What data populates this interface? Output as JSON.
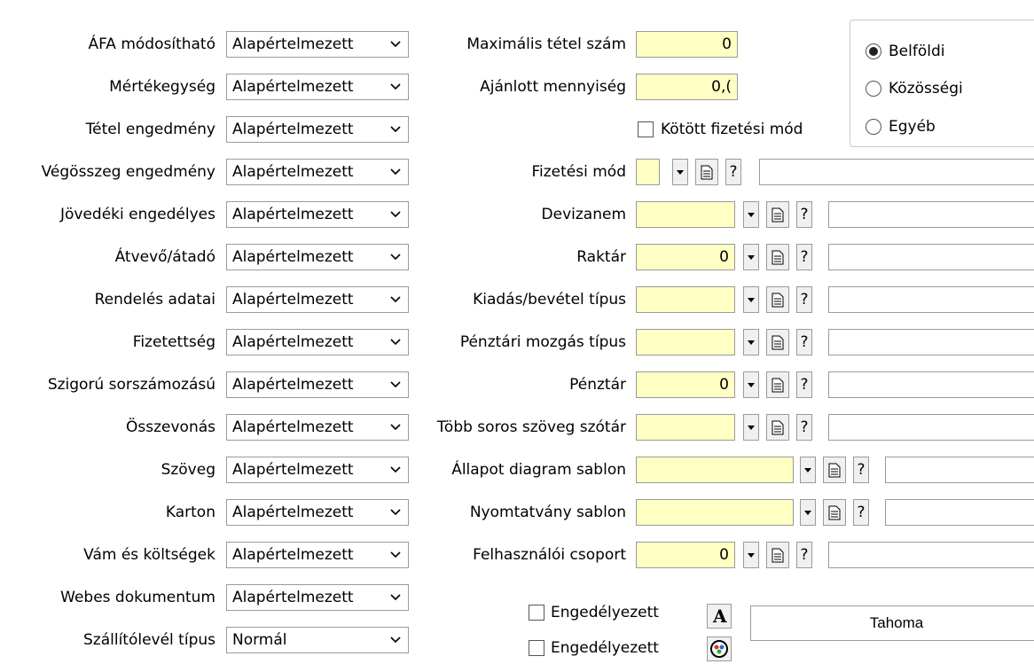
{
  "left_rows": [
    {
      "label": "ÁFA módosítható",
      "value": "Alapértelmezett"
    },
    {
      "label": "Mértékegység",
      "value": "Alapértelmezett"
    },
    {
      "label": "Tétel engedmény",
      "value": "Alapértelmezett"
    },
    {
      "label": "Végösszeg engedmény",
      "value": "Alapértelmezett"
    },
    {
      "label": "Jövedéki engedélyes",
      "value": "Alapértelmezett"
    },
    {
      "label": "Átvevő/átadó",
      "value": "Alapértelmezett"
    },
    {
      "label": "Rendelés adatai",
      "value": "Alapértelmezett"
    },
    {
      "label": "Fizetettség",
      "value": "Alapértelmezett"
    },
    {
      "label": "Szigorú sorszámozású",
      "value": "Alapértelmezett"
    },
    {
      "label": "Összevonás",
      "value": "Alapértelmezett"
    },
    {
      "label": "Szöveg",
      "value": "Alapértelmezett"
    },
    {
      "label": "Karton",
      "value": "Alapértelmezett"
    },
    {
      "label": "Vám és költségek",
      "value": "Alapértelmezett"
    },
    {
      "label": "Webes dokumentum",
      "value": "Alapértelmezett"
    },
    {
      "label": "Szállítólevél típus",
      "value": "Normál"
    }
  ],
  "middle": {
    "max_tetel": {
      "label": "Maximális tétel szám",
      "value": "0"
    },
    "ajanlott": {
      "label": "Ajánlott mennyiség",
      "value": "0,("
    },
    "kotott": {
      "label": "Kötött fizetési mód"
    },
    "fizetesi_mod": {
      "label": "Fizetési mód",
      "value": ""
    },
    "devizanem": {
      "label": "Devizanem",
      "value": ""
    },
    "raktar": {
      "label": "Raktár",
      "value": "0"
    },
    "kiadas": {
      "label": "Kiadás/bevétel típus",
      "value": ""
    },
    "penztari_mozgas": {
      "label": "Pénztári mozgás típus",
      "value": ""
    },
    "penztar": {
      "label": "Pénztár",
      "value": "0"
    },
    "tobb_soros": {
      "label": "Több soros szöveg szótár",
      "value": ""
    },
    "allapot": {
      "label": "Állapot diagram sablon",
      "value": ""
    },
    "nyomtatvany": {
      "label": "Nyomtatvány sablon",
      "value": ""
    },
    "felhasznaloi": {
      "label": "Felhasználói csoport",
      "value": "0"
    },
    "engedelyezett_1": {
      "label": "Engedélyezett"
    },
    "engedelyezett_2": {
      "label": "Engedélyezett"
    },
    "question_mark": "?"
  },
  "radio_group": {
    "options": [
      "Belföldi",
      "Közösségi",
      "Egyéb"
    ],
    "selected": "Belföldi"
  },
  "font_box": {
    "value": "Tahoma"
  },
  "icons": {
    "font_button": "font-A-icon",
    "color_button": "color-palette-icon",
    "doc_button": "document-icon"
  }
}
